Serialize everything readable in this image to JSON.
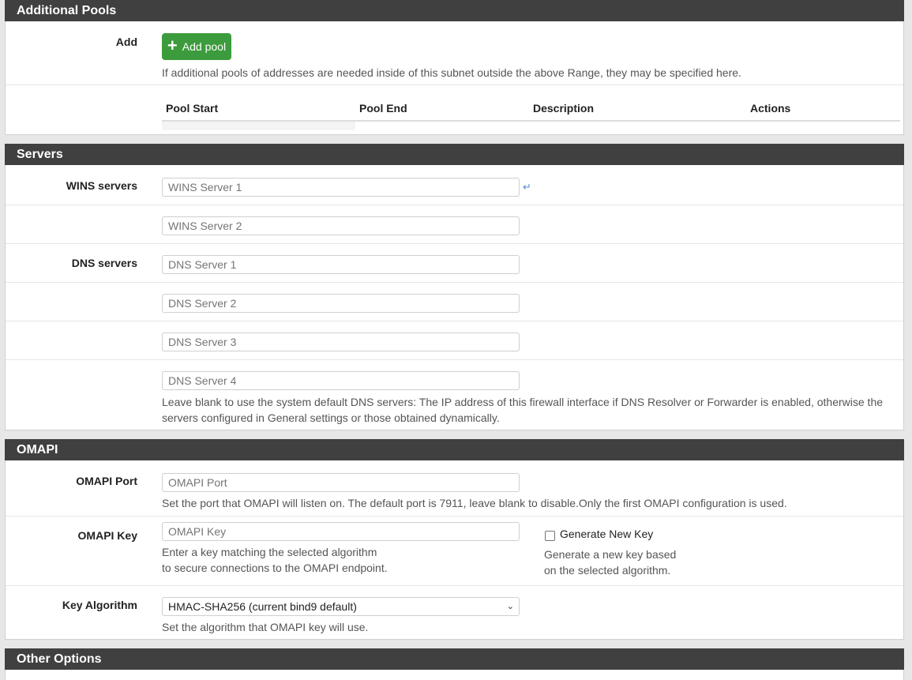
{
  "additional_pools": {
    "heading": "Additional Pools",
    "add_label": "Add",
    "add_button": "Add pool",
    "add_help": "If additional pools of addresses are needed inside of this subnet outside the above Range, they may be specified here.",
    "columns": [
      "Pool Start",
      "Pool End",
      "Description",
      "Actions"
    ]
  },
  "servers": {
    "heading": "Servers",
    "wins_label": "WINS servers",
    "wins1_placeholder": "WINS Server 1",
    "wins2_placeholder": "WINS Server 2",
    "dns_label": "DNS servers",
    "dns1_placeholder": "DNS Server 1",
    "dns2_placeholder": "DNS Server 2",
    "dns3_placeholder": "DNS Server 3",
    "dns4_placeholder": "DNS Server 4",
    "dns_help_line1": "Leave blank to use the system default DNS servers: The IP address of this firewall interface if DNS Resolver or Forwarder is enabled, otherwise the",
    "dns_help_line2": "servers configured in General settings or those obtained dynamically."
  },
  "omapi": {
    "heading": "OMAPI",
    "port_label": "OMAPI Port",
    "port_placeholder": "OMAPI Port",
    "port_help": "Set the port that OMAPI will listen on. The default port is 7911, leave blank to disable.Only the first OMAPI configuration is used.",
    "key_label": "OMAPI Key",
    "key_placeholder": "OMAPI Key",
    "key_help_line1": "Enter a key matching the selected algorithm",
    "key_help_line2": "to secure connections to the OMAPI endpoint.",
    "generate_label": "Generate New Key",
    "generate_checked": false,
    "generate_help_line1": "Generate a new key based",
    "generate_help_line2": "on the selected algorithm.",
    "algorithm_label": "Key Algorithm",
    "algorithm_value": "HMAC-SHA256 (current bind9 default)",
    "algorithm_help": "Set the algorithm that OMAPI key will use."
  },
  "other_options": {
    "heading": "Other Options"
  },
  "colors": {
    "panel_heading_bg": "#404040",
    "add_button_bg": "#3c9b3c",
    "page_bg": "#e7e7e7"
  }
}
